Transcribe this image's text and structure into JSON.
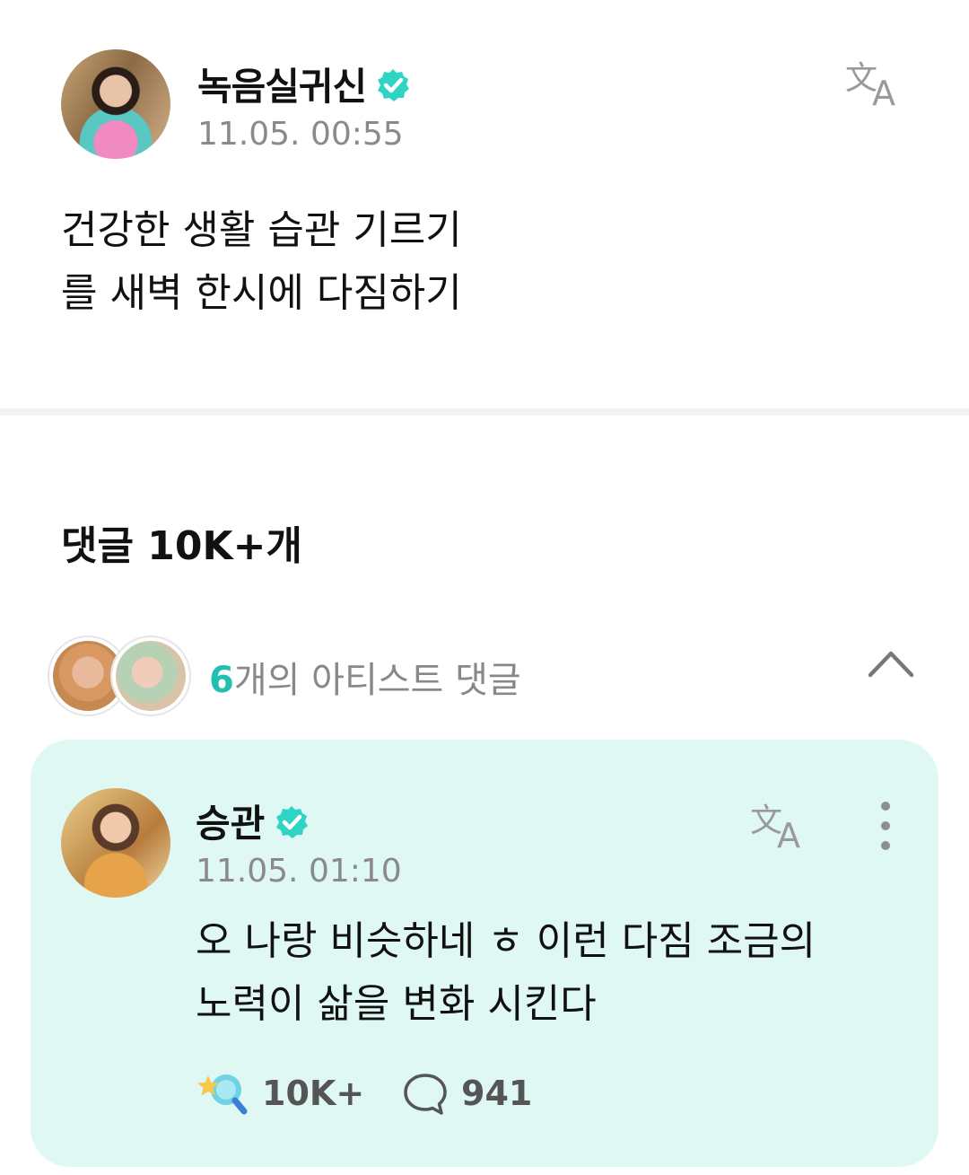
{
  "post": {
    "author": "녹음실귀신",
    "time": "11.05. 00:55",
    "body": "건강한 생활 습관 기르기\n를 새벽 한시에 다짐하기",
    "avatar_icon": "user-avatar-photo",
    "translate_icon": "translate-icon"
  },
  "comments": {
    "label": "댓글",
    "count": "10K+개"
  },
  "artist_comments": {
    "count": "6",
    "label": "개의 아티스트 댓글",
    "toggle_icon": "chevron-up-icon",
    "accent_color": "#1fbfb1"
  },
  "comment": {
    "author": "승관",
    "time": "11.05. 01:10",
    "text": "오 나랑 비슷하네 ㅎ 이런 다짐 조금의\n노력이 삶을 변화 시킨다",
    "likes": "10K+",
    "replies": "941",
    "card_color": "#dff8f3",
    "verified_color": "#2fd5c4"
  }
}
